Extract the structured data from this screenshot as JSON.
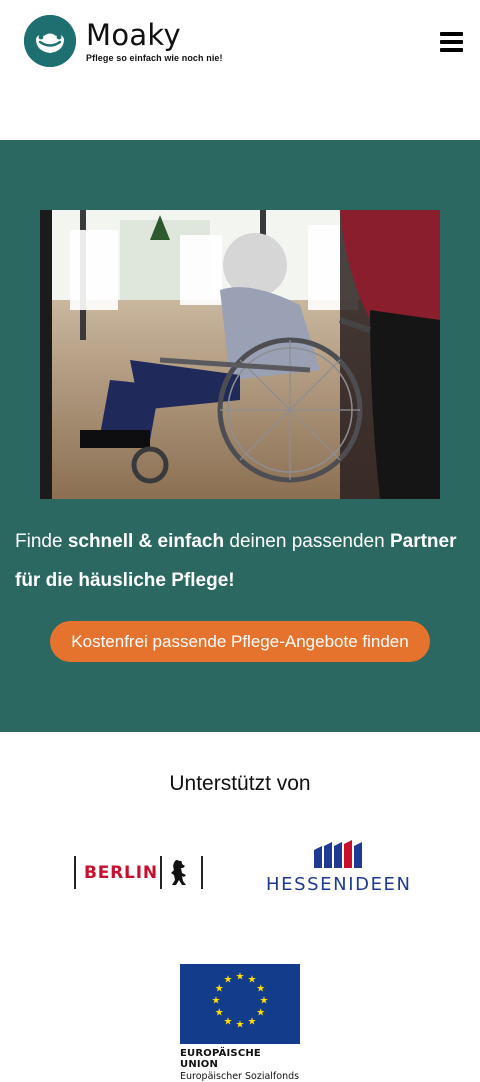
{
  "header": {
    "brand_name": "Moaky",
    "tagline": "Pflege so einfach wie noch nie!",
    "menu_icon": "hamburger-menu-icon"
  },
  "hero": {
    "image_description": "",
    "text_part1": "Finde ",
    "text_bold1": "schnell & einfach",
    "text_part2": " deinen passenden ",
    "text_bold2": "Partner für die häusliche Pflege!",
    "cta_label": "Kostenfrei passende Pflege-Angebote finden"
  },
  "supported": {
    "title": "Unterstützt von",
    "berlin_label": "BERLIN",
    "hessen_label_1": "HESSEN",
    "hessen_label_2": "IDEEN",
    "eu_line1": "EUROPÄISCHE UNION",
    "eu_line2": "Europäischer Sozialfonds"
  },
  "colors": {
    "brand_teal": "#1e7070",
    "hero_bg": "#2a6861",
    "cta_orange": "#e5732d",
    "berlin_red": "#c8102e",
    "hessen_blue": "#1f3a93",
    "eu_blue": "#133c8b",
    "eu_star": "#ffdd00"
  }
}
